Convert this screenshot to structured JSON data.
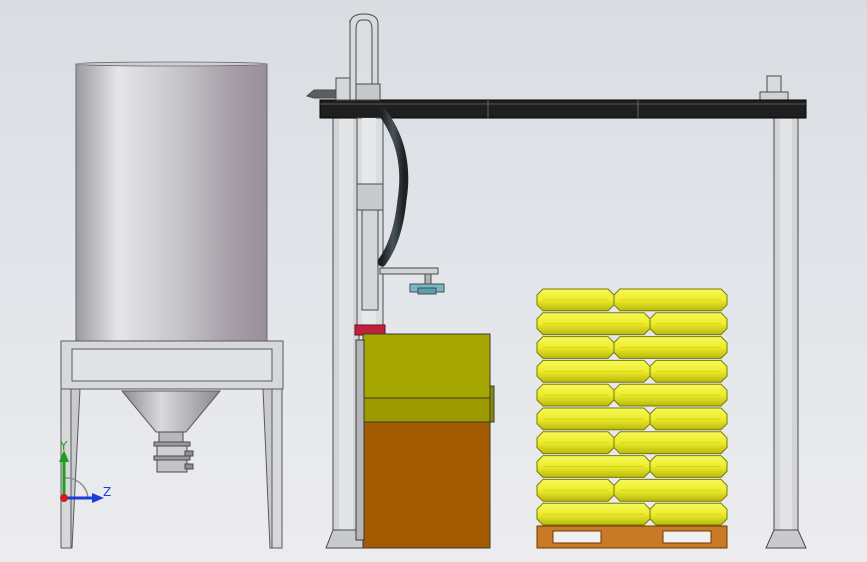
{
  "colors": {
    "background": "#e3e6ea",
    "silo": "#c4c4c8",
    "frame": "#d4d6d8",
    "beam": "#2a2a2a",
    "bag": "#ecec2e",
    "bag_shade": "#c8c810",
    "pallet": "#c97a24",
    "machine_top": "#a6a600",
    "machine_bottom": "#a35a00",
    "hose": "#2e3538",
    "accent_red": "#c0203a",
    "axis_y": "#1e9e1e",
    "axis_z": "#1e3cdc",
    "axis_origin": "#d01e1e"
  },
  "axes": {
    "y_label": "Y",
    "z_label": "Z"
  },
  "pallet_stack": {
    "layers": 10,
    "pattern": [
      [
        "long",
        "short"
      ],
      [
        "short",
        "long"
      ]
    ]
  }
}
